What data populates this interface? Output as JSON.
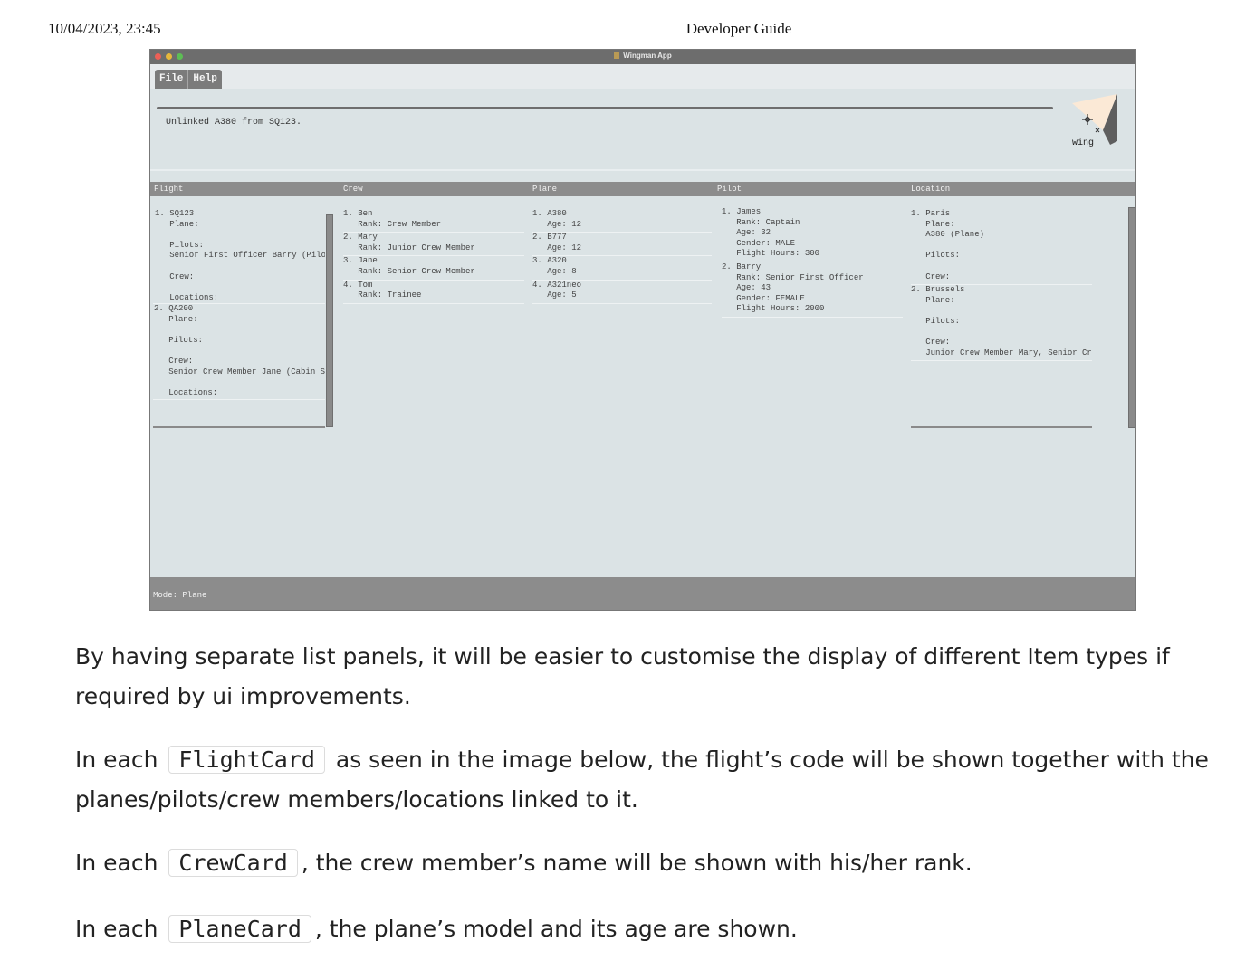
{
  "print_header": {
    "datetime": "10/04/2023, 23:45",
    "title": "Developer Guide"
  },
  "window": {
    "title": "Wingman App"
  },
  "menu": [
    {
      "label": "File"
    },
    {
      "label": "Help"
    }
  ],
  "result": {
    "text": "Unlinked A380 from SQ123.",
    "logo_text": "wing"
  },
  "columns": {
    "flight": "Flight",
    "crew": "Crew",
    "plane": "Plane",
    "pilot": "Pilot",
    "location": "Location"
  },
  "flights": [
    {
      "lines": [
        "1. SQ123",
        "   Plane:",
        "",
        "   Pilots:",
        "   Senior First Officer Barry (Pilo",
        "",
        "   Crew:",
        "",
        "   Locations:"
      ]
    },
    {
      "lines": [
        "2. QA200",
        "   Plane:",
        "",
        "   Pilots:",
        "",
        "   Crew:",
        "   Senior Crew Member Jane (Cabin Se",
        "",
        "   Locations:"
      ]
    }
  ],
  "crew": [
    {
      "lines": [
        "1. Ben",
        "   Rank: Crew Member"
      ]
    },
    {
      "lines": [
        "2. Mary",
        "   Rank: Junior Crew Member"
      ]
    },
    {
      "lines": [
        "3. Jane",
        "   Rank: Senior Crew Member"
      ]
    },
    {
      "lines": [
        "4. Tom",
        "   Rank: Trainee"
      ]
    }
  ],
  "planes": [
    {
      "lines": [
        "1. A380",
        "   Age: 12"
      ]
    },
    {
      "lines": [
        "2. B777",
        "   Age: 12"
      ]
    },
    {
      "lines": [
        "3. A320",
        "   Age: 8"
      ]
    },
    {
      "lines": [
        "4. A321neo",
        "   Age: 5"
      ]
    }
  ],
  "pilots": [
    {
      "lines": [
        "1. James",
        "   Rank: Captain",
        "   Age: 32",
        "   Gender: MALE",
        "   Flight Hours: 300"
      ]
    },
    {
      "lines": [
        "2. Barry",
        "   Rank: Senior First Officer",
        "   Age: 43",
        "   Gender: FEMALE",
        "   Flight Hours: 2000"
      ]
    }
  ],
  "locations": [
    {
      "lines": [
        "1. Paris",
        "   Plane:",
        "   A380 (Plane)",
        "",
        "   Pilots:",
        "",
        "   Crew:"
      ]
    },
    {
      "lines": [
        "2. Brussels",
        "   Plane:",
        "",
        "   Pilots:",
        "",
        "   Crew:",
        "   Junior Crew Member Mary, Senior Cr"
      ]
    }
  ],
  "status": {
    "mode": "Mode: Plane"
  },
  "doc": {
    "p1": "By having separate list panels, it will be easier to customise the display of different Item types if required by ui improvements.",
    "p2_a": "In each",
    "p2_code": "FlightCard",
    "p2_b": "as seen in the image below, the flight’s code will be shown together with the planes/pilots/crew members/locations linked to it.",
    "p3_a": "In each",
    "p3_code": "CrewCard",
    "p3_b": ", the crew member’s name will be shown with his/her rank.",
    "p4_a": "In each",
    "p4_code": "PlaneCard",
    "p4_b": ", the plane’s model and its age are shown."
  },
  "colors": {
    "window_bg": "#dbe3e5",
    "bar_gray": "#8c8c8c",
    "titlebar": "#6d6d6d"
  },
  "icons": [
    "close-icon",
    "minimize-icon",
    "zoom-icon",
    "app-icon",
    "wingman-logo-icon"
  ]
}
